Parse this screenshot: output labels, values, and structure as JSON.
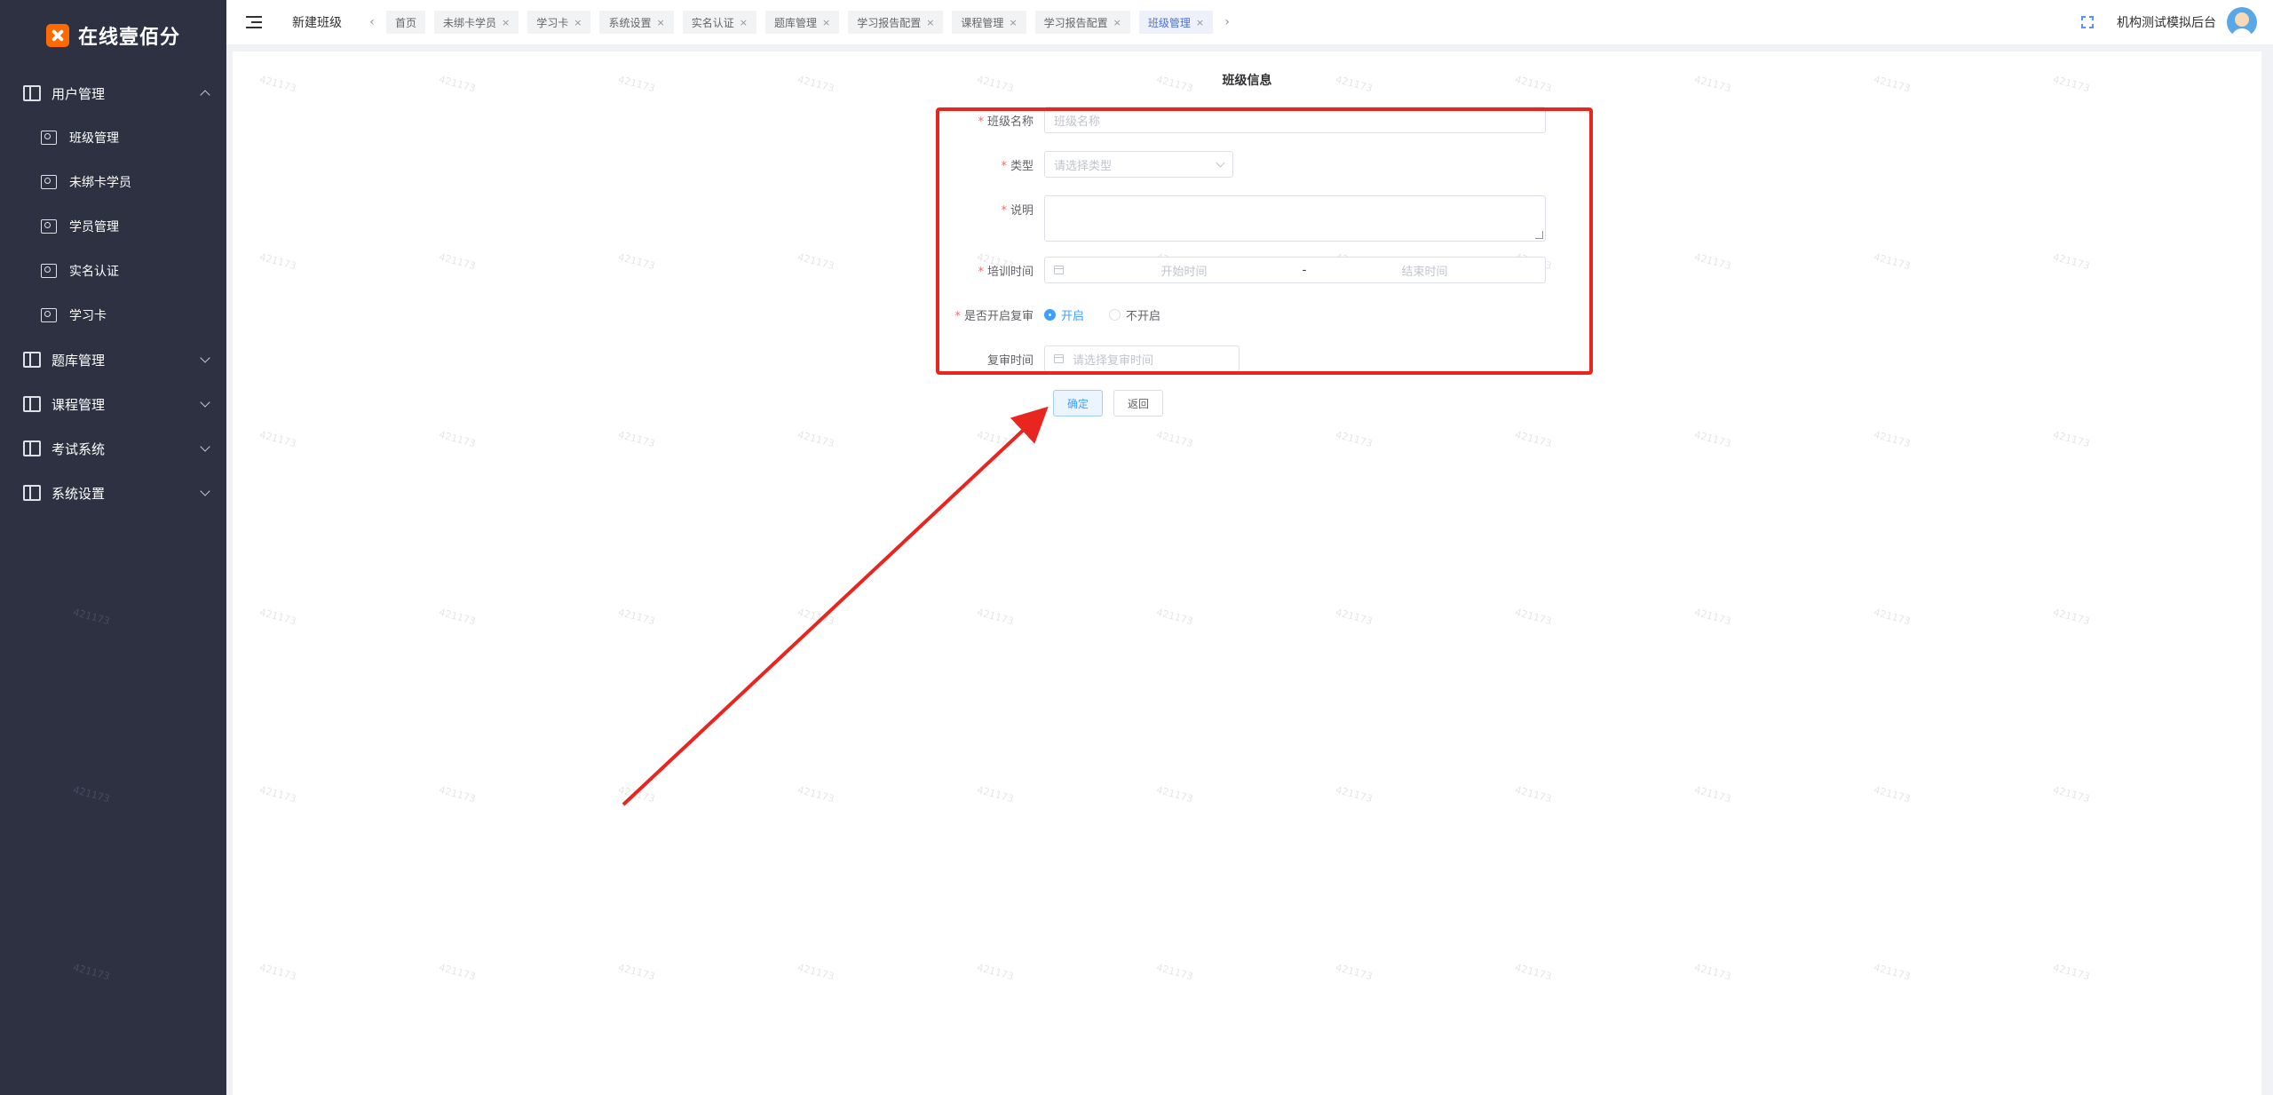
{
  "sidebar": {
    "logo_text": "在线壹佰分",
    "menu": [
      {
        "label": "用户管理",
        "icon": "book-icon",
        "expanded": true,
        "children": [
          {
            "label": "班级管理",
            "icon": "user-card-icon"
          },
          {
            "label": "未绑卡学员",
            "icon": "book-icon"
          },
          {
            "label": "学员管理",
            "icon": "user-card-icon"
          },
          {
            "label": "实名认证",
            "icon": "user-card-icon"
          },
          {
            "label": "学习卡",
            "icon": "user-card-icon"
          }
        ]
      },
      {
        "label": "题库管理",
        "icon": "book-icon",
        "expanded": false
      },
      {
        "label": "课程管理",
        "icon": "book-icon",
        "expanded": false
      },
      {
        "label": "考试系统",
        "icon": "book-icon",
        "expanded": false
      },
      {
        "label": "系统设置",
        "icon": "book-icon",
        "expanded": false
      }
    ]
  },
  "header": {
    "page_name": "新建班级",
    "tabs": [
      {
        "label": "首页",
        "closable": false,
        "active": false
      },
      {
        "label": "未绑卡学员",
        "closable": true,
        "active": false
      },
      {
        "label": "学习卡",
        "closable": true,
        "active": false
      },
      {
        "label": "系统设置",
        "closable": true,
        "active": false
      },
      {
        "label": "实名认证",
        "closable": true,
        "active": false
      },
      {
        "label": "题库管理",
        "closable": true,
        "active": false
      },
      {
        "label": "学习报告配置",
        "closable": true,
        "active": false
      },
      {
        "label": "课程管理",
        "closable": true,
        "active": false
      },
      {
        "label": "学习报告配置",
        "closable": true,
        "active": false
      },
      {
        "label": "班级管理",
        "closable": true,
        "active": true
      }
    ],
    "tab_close_glyph": "×",
    "tab_prev_glyph": "‹",
    "tab_next_glyph": "›",
    "org_name": "机构测试模拟后台"
  },
  "form": {
    "title": "班级信息",
    "fields": {
      "name": {
        "label": "班级名称",
        "required": true,
        "placeholder": "班级名称"
      },
      "type": {
        "label": "类型",
        "required": true,
        "placeholder": "请选择类型"
      },
      "desc": {
        "label": "说明",
        "required": true
      },
      "training_time": {
        "label": "培训时间",
        "required": true,
        "start_placeholder": "开始时间",
        "end_placeholder": "结束时间",
        "separator": "-"
      },
      "review": {
        "label": "是否开启复审",
        "required": true,
        "options": [
          "开启",
          "不开启"
        ],
        "selected": "开启"
      },
      "review_time": {
        "label": "复审时间",
        "required": false,
        "placeholder": "请选择复审时间"
      }
    },
    "required_mark": "*",
    "buttons": {
      "confirm": "确定",
      "back": "返回"
    }
  },
  "watermark_text": "421173",
  "colors": {
    "sidebar_bg": "#2d3142",
    "accent": "#409eff",
    "active_tab": "#4a70e2",
    "annotation": "#e8251f",
    "logo": "#ff6a00"
  }
}
